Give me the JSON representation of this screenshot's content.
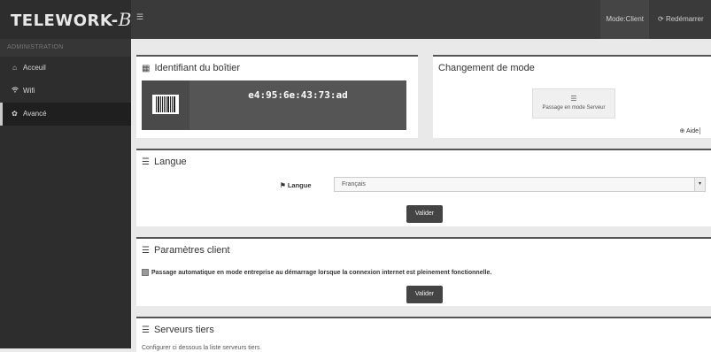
{
  "sidebar": {
    "logo_main": "TELEWORK-",
    "logo_box": "Box",
    "section_label": "ADMINISTRATION",
    "items": [
      {
        "label": "Acceuil",
        "icon": "home-icon"
      },
      {
        "label": "Wifi",
        "icon": "wifi-icon"
      },
      {
        "label": "Avancé",
        "icon": "gear-icon"
      }
    ]
  },
  "topbar": {
    "menu_icon": "hamburger-icon",
    "mode": "Mode:Client",
    "restart": "Redémarrer"
  },
  "identifier_panel": {
    "title": "Identifiant du boîtier",
    "mac": "e4:95:6e:43:73:ad"
  },
  "mode_panel": {
    "title": "Changement de mode",
    "button_label": "Passage en mode Serveur",
    "help_label": "Aide"
  },
  "language_panel": {
    "title": "Langue",
    "field_label": "Langue",
    "selected": "Français",
    "submit_label": "Valider"
  },
  "client_panel": {
    "title": "Paramètres client",
    "option_label": "Passage automatique en mode entreprise au démarrage lorsque la connexion internet est pleinement fonctionnelle.",
    "submit_label": "Valider"
  },
  "servers_panel": {
    "title": "Serveurs tiers",
    "description": "Configurer ci dessous la liste serveurs tiers"
  }
}
